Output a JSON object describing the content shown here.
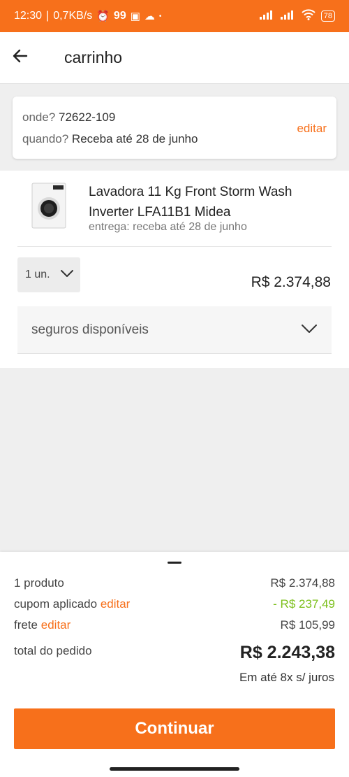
{
  "status_bar": {
    "time": "12:30",
    "network_speed": "0,7KB/s",
    "notification_count": "99",
    "battery": "78"
  },
  "header": {
    "title": "carrinho"
  },
  "delivery": {
    "where_label": "onde?",
    "zip": "72622-109",
    "when_label": "quando?",
    "when_value": "Receba até 28 de junho",
    "edit_label": "editar"
  },
  "product": {
    "name": "Lavadora 11 Kg Front Storm Wash Inverter LFA11B1 Midea",
    "delivery": "entrega: receba até 28 de junho",
    "quantity": "1 un.",
    "price": "R$ 2.374,88",
    "insurance_label": "seguros disponíveis"
  },
  "summary": {
    "products_label": "1 produto",
    "products_value": "R$ 2.374,88",
    "coupon_label": "cupom aplicado",
    "coupon_edit": "editar",
    "coupon_value": "- R$ 237,49",
    "shipping_label": "frete",
    "shipping_edit": "editar",
    "shipping_value": "R$ 105,99",
    "total_label": "total do pedido",
    "total_value": "R$ 2.243,38",
    "installments": "Em até 8x s/ juros",
    "continue_label": "Continuar"
  },
  "colors": {
    "accent": "#f7701b",
    "discount": "#7bbf1a"
  }
}
